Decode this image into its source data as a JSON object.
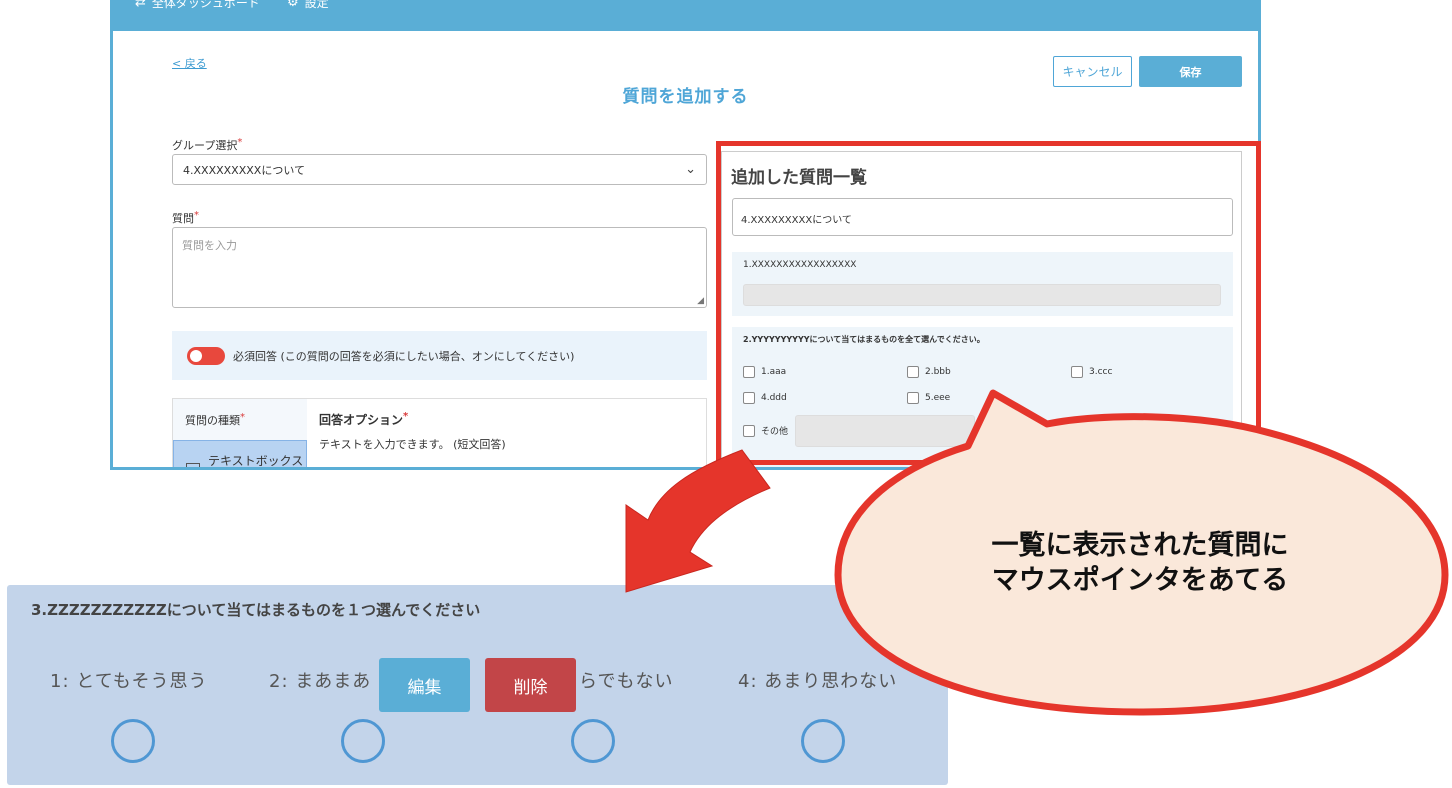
{
  "topbar": {
    "item1_label": "全体ダッシュボード",
    "item2_label": "設定"
  },
  "header": {
    "back_label": "< 戻る",
    "title": "質問を追加する",
    "cancel_label": "キャンセル",
    "save_label": "保存"
  },
  "form": {
    "group_label": "グループ選択",
    "group_value": "4.XXXXXXXXXについて",
    "question_label": "質問",
    "question_placeholder": "質問を入力",
    "required_label": "必須回答 (この質問の回答を必須にしたい場合、オンにしてください)",
    "type_label": "質問の種類",
    "type_option": "テキストボックス",
    "answer_option_title": "回答オプション",
    "answer_option_desc": "テキストを入力できます。 (短文回答)"
  },
  "list": {
    "title": "追加した質問一覧",
    "group": "4.XXXXXXXXXについて",
    "q1": "1.XXXXXXXXXXXXXXXXX",
    "q2": "2.YYYYYYYYYYについて当てはまるものを全て選んでください。",
    "q2_options": [
      "1.aaa",
      "2.bbb",
      "3.ccc",
      "4.ddd",
      "5.eee",
      "その他"
    ]
  },
  "zoom": {
    "title": "3.ZZZZZZZZZZZについて当てはまるものを１つ選んでください",
    "scale": [
      "1:  とてもそう思う",
      "2:  まあまあ",
      "らでもない",
      "4:  あまり思わない"
    ],
    "edit_label": "編集",
    "delete_label": "削除"
  },
  "callout": {
    "line1": "一覧に表示された質問に",
    "line2": "マウスポインタをあてる"
  },
  "colors": {
    "accent": "#5aaed6",
    "highlight": "#e5352b",
    "bubble_fill": "#fae8da",
    "zoom_bg": "#c3d4ea",
    "delete": "#c24548"
  }
}
